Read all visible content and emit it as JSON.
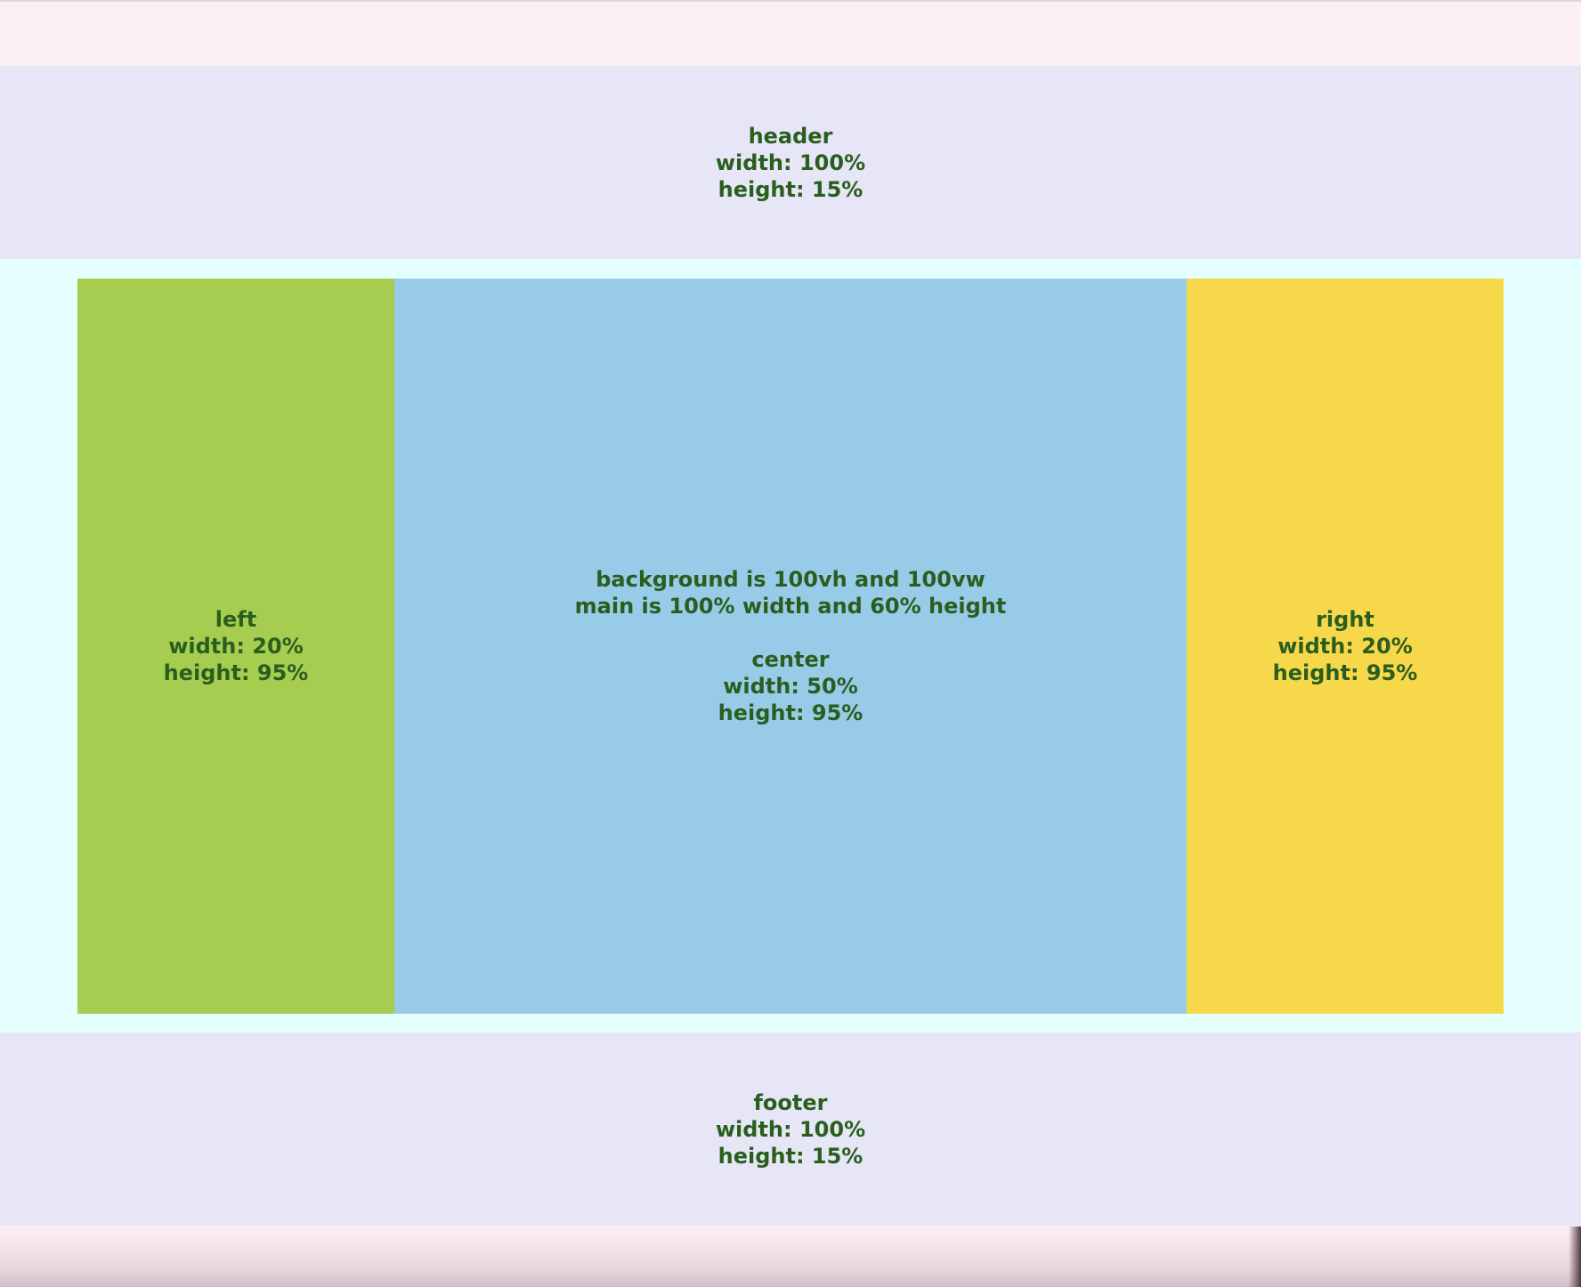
{
  "header": {
    "lines": [
      "header",
      "width: 100%",
      "height: 15%"
    ]
  },
  "left": {
    "lines": [
      "left",
      "width: 20%",
      "height: 95%"
    ]
  },
  "center": {
    "intro_lines": [
      "background is 100vh and 100vw",
      "main is 100% width and 60% height"
    ],
    "lines": [
      "center",
      "width: 50%",
      "height: 95%"
    ]
  },
  "right": {
    "lines": [
      "right",
      "width: 20%",
      "height: 95%"
    ]
  },
  "footer": {
    "lines": [
      "footer",
      "width: 100%",
      "height: 15%"
    ]
  },
  "colors": {
    "background": "#fdf0f4",
    "header_footer": "#e6e6f7",
    "main": "#e5fffe",
    "left": "#a6cd50",
    "center": "#97cbe8",
    "right": "#f7d84a",
    "text": "#2a5e1e"
  }
}
